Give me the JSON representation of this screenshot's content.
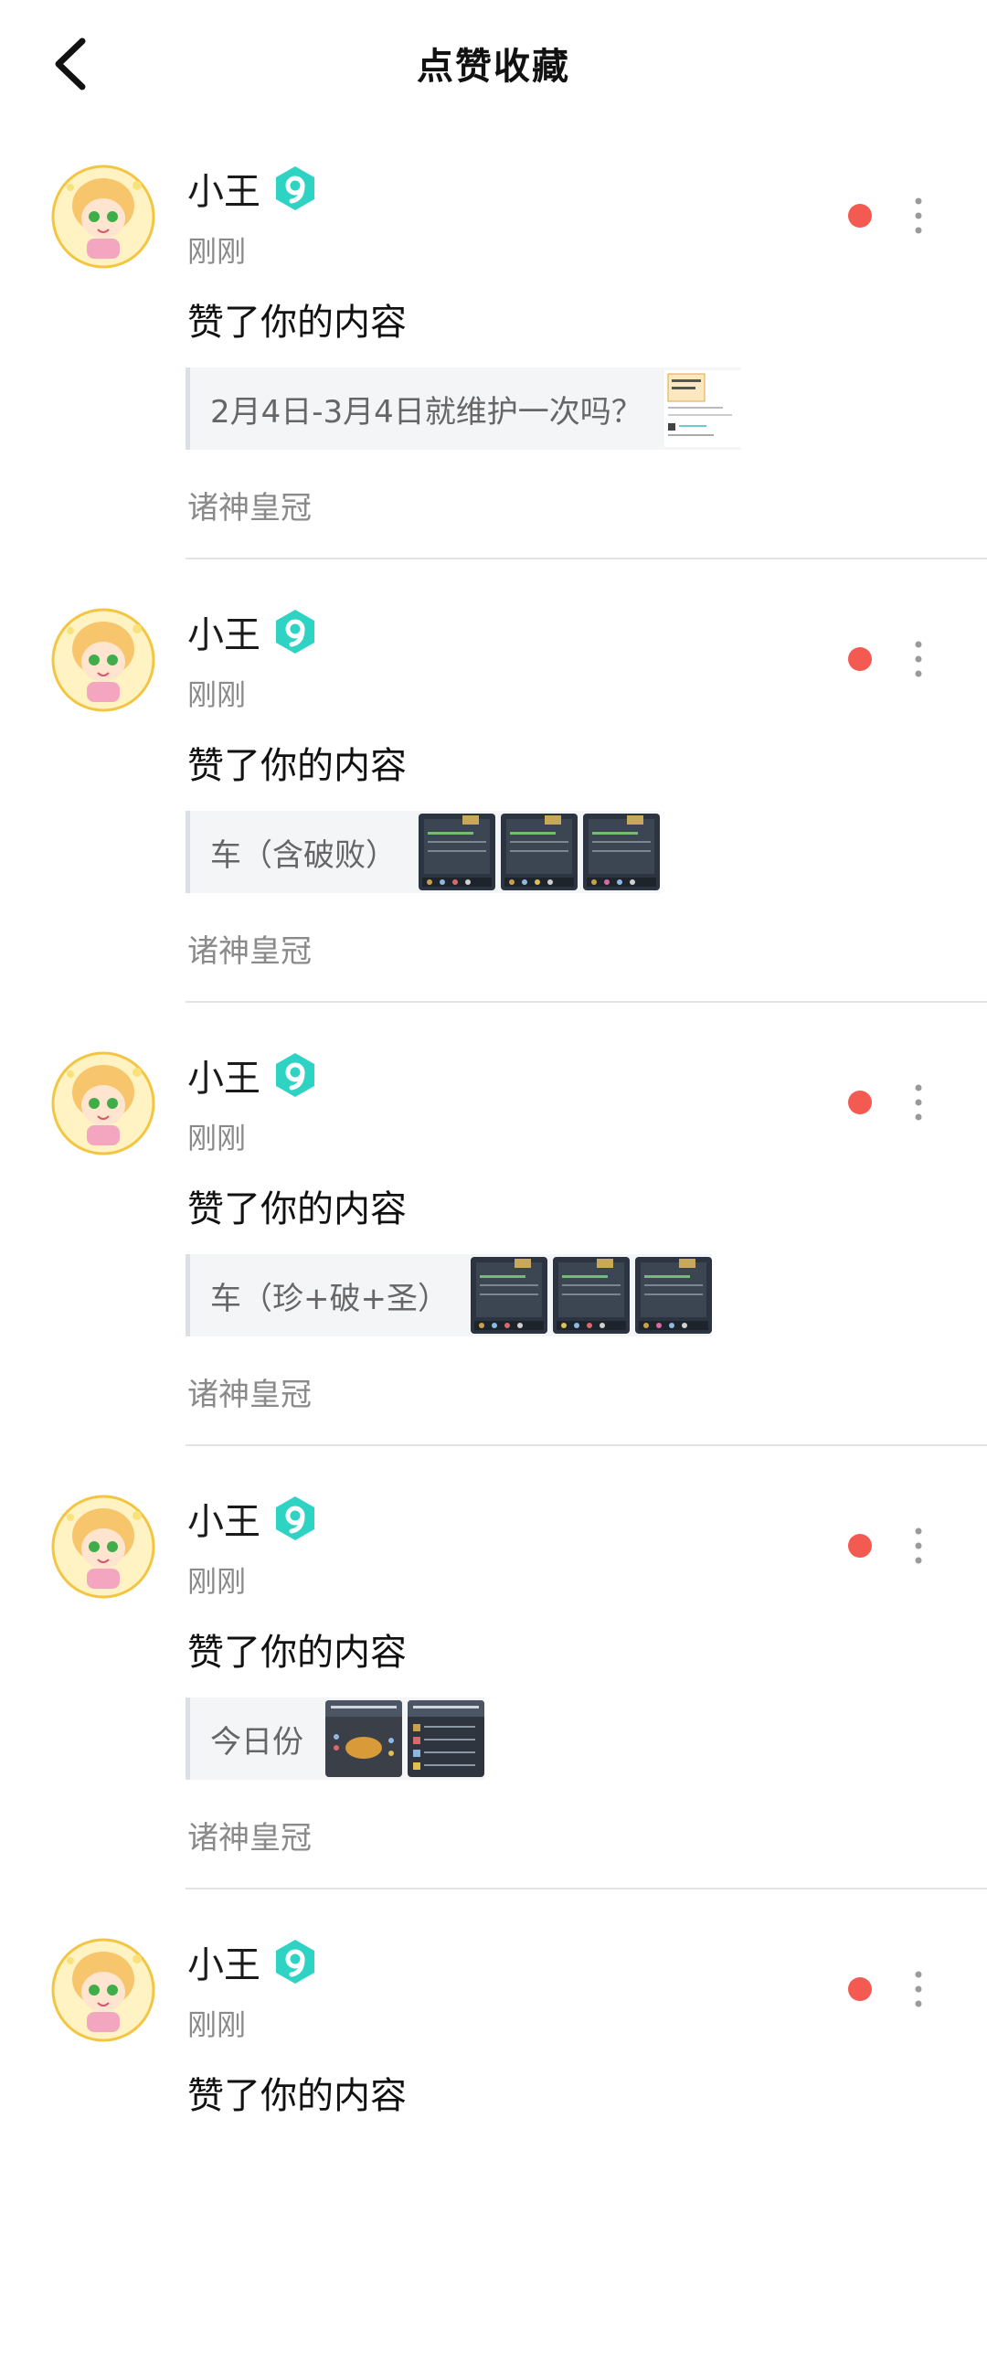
{
  "header": {
    "title": "点赞收藏"
  },
  "items": [
    {
      "name": "小王",
      "time": "刚刚",
      "action": "赞了你的内容",
      "ref_text": "2月4日-3月4日就维护一次吗？",
      "source": "诸神皇冠"
    },
    {
      "name": "小王",
      "time": "刚刚",
      "action": "赞了你的内容",
      "ref_text": "车（含破败）",
      "source": "诸神皇冠"
    },
    {
      "name": "小王",
      "time": "刚刚",
      "action": "赞了你的内容",
      "ref_text": "车（珍+破+圣）",
      "source": "诸神皇冠"
    },
    {
      "name": "小王",
      "time": "刚刚",
      "action": "赞了你的内容",
      "ref_text": "今日份",
      "source": "诸神皇冠"
    },
    {
      "name": "小王",
      "time": "刚刚",
      "action": "赞了你的内容",
      "ref_text": "",
      "source": ""
    }
  ],
  "colors": {
    "unread_dot": "#f25a52",
    "level_badge": "#2fd3c4"
  }
}
